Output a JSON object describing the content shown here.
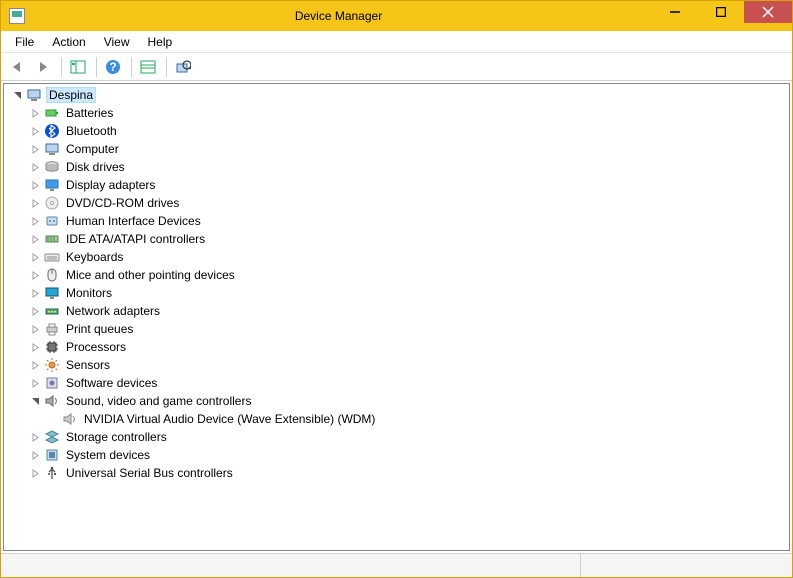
{
  "window": {
    "title": "Device Manager"
  },
  "menu": {
    "items": [
      "File",
      "Action",
      "View",
      "Help"
    ]
  },
  "toolbar": {
    "buttons": [
      "back",
      "forward",
      "show-hide-tree",
      "help",
      "properties",
      "scan-hardware"
    ]
  },
  "tree": {
    "root": {
      "label": "Despina",
      "icon": "computer-icon",
      "expanded": true,
      "selected": true,
      "children": [
        {
          "label": "Batteries",
          "icon": "battery-icon",
          "expanded": false,
          "hasChildren": true
        },
        {
          "label": "Bluetooth",
          "icon": "bluetooth-icon",
          "expanded": false,
          "hasChildren": true
        },
        {
          "label": "Computer",
          "icon": "computer-icon",
          "expanded": false,
          "hasChildren": true
        },
        {
          "label": "Disk drives",
          "icon": "disk-icon",
          "expanded": false,
          "hasChildren": true
        },
        {
          "label": "Display adapters",
          "icon": "display-icon",
          "expanded": false,
          "hasChildren": true
        },
        {
          "label": "DVD/CD-ROM drives",
          "icon": "dvd-icon",
          "expanded": false,
          "hasChildren": true
        },
        {
          "label": "Human Interface Devices",
          "icon": "hid-icon",
          "expanded": false,
          "hasChildren": true
        },
        {
          "label": "IDE ATA/ATAPI controllers",
          "icon": "ide-icon",
          "expanded": false,
          "hasChildren": true
        },
        {
          "label": "Keyboards",
          "icon": "keyboard-icon",
          "expanded": false,
          "hasChildren": true
        },
        {
          "label": "Mice and other pointing devices",
          "icon": "mouse-icon",
          "expanded": false,
          "hasChildren": true
        },
        {
          "label": "Monitors",
          "icon": "monitor-icon",
          "expanded": false,
          "hasChildren": true
        },
        {
          "label": "Network adapters",
          "icon": "network-icon",
          "expanded": false,
          "hasChildren": true
        },
        {
          "label": "Print queues",
          "icon": "printer-icon",
          "expanded": false,
          "hasChildren": true
        },
        {
          "label": "Processors",
          "icon": "processor-icon",
          "expanded": false,
          "hasChildren": true
        },
        {
          "label": "Sensors",
          "icon": "sensor-icon",
          "expanded": false,
          "hasChildren": true
        },
        {
          "label": "Software devices",
          "icon": "software-icon",
          "expanded": false,
          "hasChildren": true
        },
        {
          "label": "Sound, video and game controllers",
          "icon": "sound-icon",
          "expanded": true,
          "hasChildren": true,
          "children": [
            {
              "label": "NVIDIA Virtual Audio Device (Wave Extensible) (WDM)",
              "icon": "speaker-icon",
              "expanded": false,
              "hasChildren": false
            }
          ]
        },
        {
          "label": "Storage controllers",
          "icon": "storage-icon",
          "expanded": false,
          "hasChildren": true
        },
        {
          "label": "System devices",
          "icon": "system-icon",
          "expanded": false,
          "hasChildren": true
        },
        {
          "label": "Universal Serial Bus controllers",
          "icon": "usb-icon",
          "expanded": false,
          "hasChildren": true
        }
      ]
    }
  }
}
